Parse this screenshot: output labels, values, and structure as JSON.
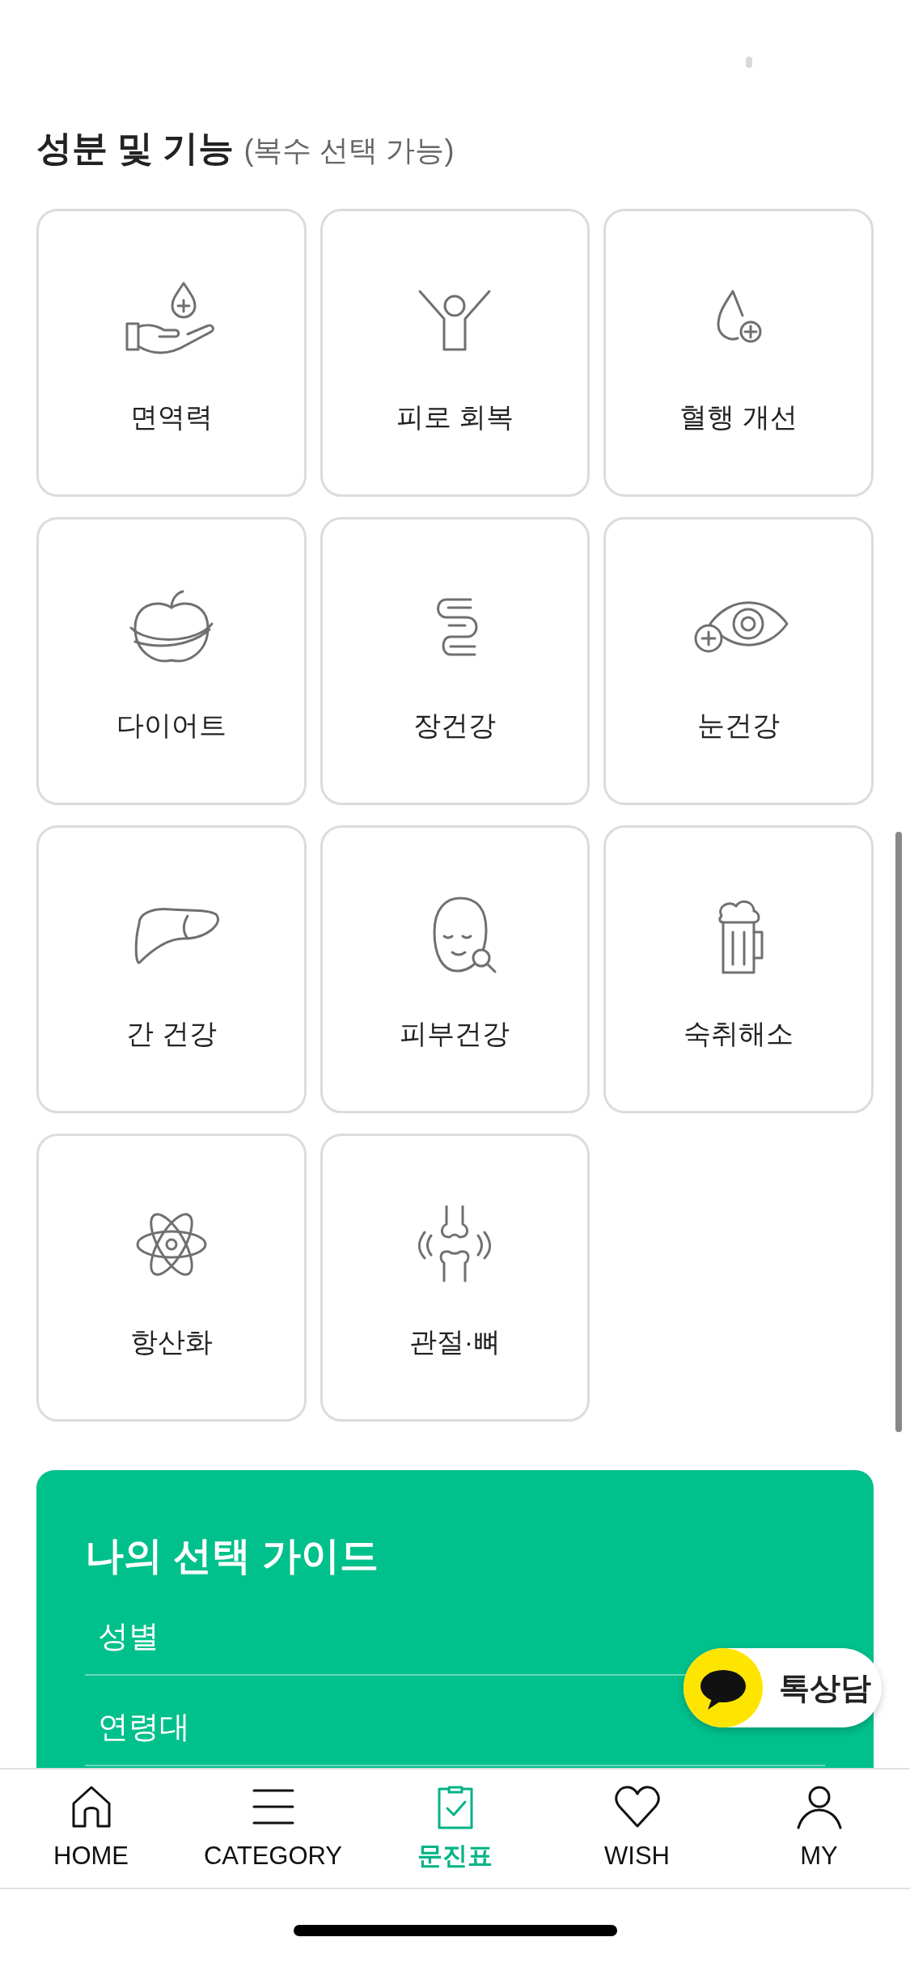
{
  "section": {
    "title": "성분 및 기능",
    "note": "(복수 선택 가능)"
  },
  "features": [
    {
      "label": "면역력"
    },
    {
      "label": "피로 회복"
    },
    {
      "label": "혈행 개선"
    },
    {
      "label": "다이어트"
    },
    {
      "label": "장건강"
    },
    {
      "label": "눈건강"
    },
    {
      "label": "간 건강"
    },
    {
      "label": "피부건강"
    },
    {
      "label": "숙취해소"
    },
    {
      "label": "항산화"
    },
    {
      "label": "관절·뼈"
    }
  ],
  "guide": {
    "title": "나의 선택 가이드",
    "fields": [
      "성별",
      "연령대"
    ]
  },
  "chat_button": {
    "label": "톡상담"
  },
  "nav": [
    {
      "label": "HOME",
      "selected": false
    },
    {
      "label": "CATEGORY",
      "selected": false
    },
    {
      "label": "문진표",
      "selected": true
    },
    {
      "label": "WISH",
      "selected": false
    },
    {
      "label": "MY",
      "selected": false
    }
  ]
}
